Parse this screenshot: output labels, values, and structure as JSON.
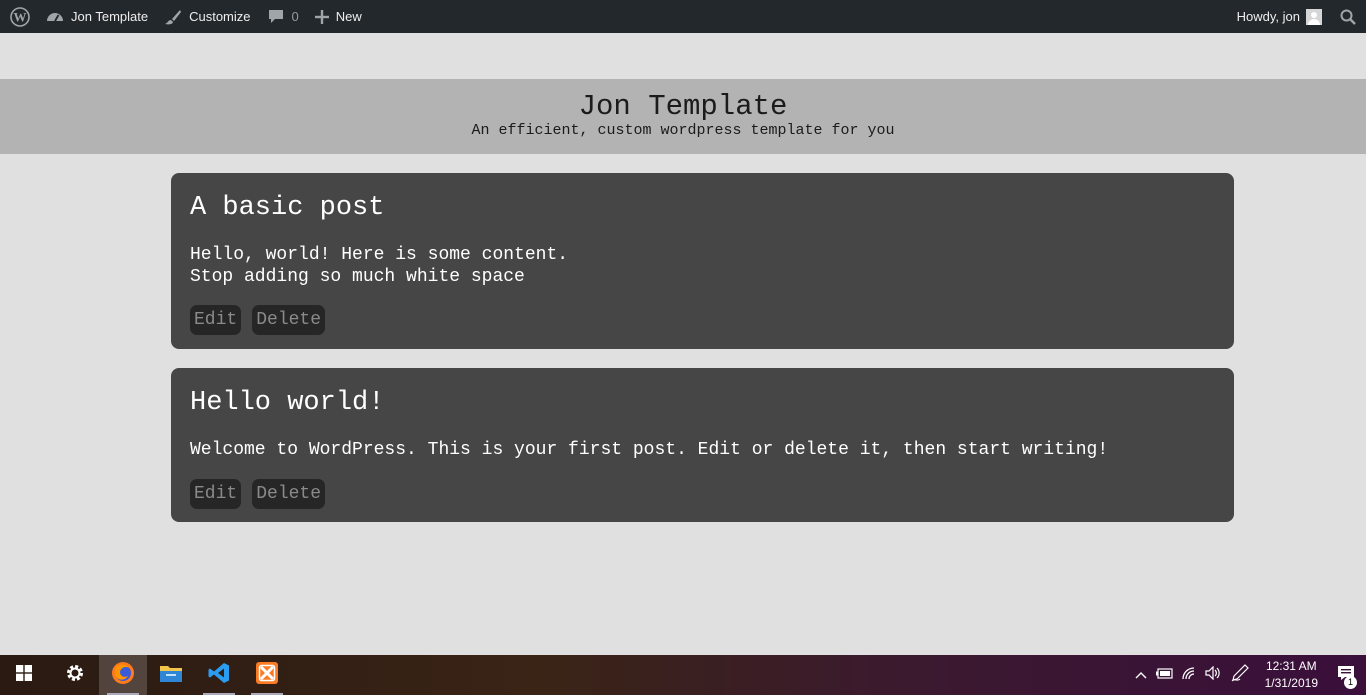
{
  "adminbar": {
    "site_name": "Jon Template",
    "customize_label": "Customize",
    "comments_count": "0",
    "new_label": "New",
    "greeting": "Howdy, jon"
  },
  "site": {
    "title": "Jon Template",
    "description": "An efficient, custom wordpress template for you"
  },
  "posts": [
    {
      "title": "A basic post",
      "body": "Hello, world! Here is some content.\nStop adding so much white space",
      "edit_label": "Edit",
      "delete_label": "Delete"
    },
    {
      "title": "Hello world!",
      "body": "Welcome to WordPress. This is your first post. Edit or delete it, then start writing!",
      "edit_label": "Edit",
      "delete_label": "Delete"
    }
  ],
  "taskbar": {
    "apps": [
      "start-icon",
      "settings-icon",
      "firefox-icon",
      "file-explorer-icon",
      "vscode-icon",
      "xampp-icon"
    ],
    "clock_time": "12:31 AM",
    "clock_date": "1/31/2019",
    "notification_count": "1"
  }
}
